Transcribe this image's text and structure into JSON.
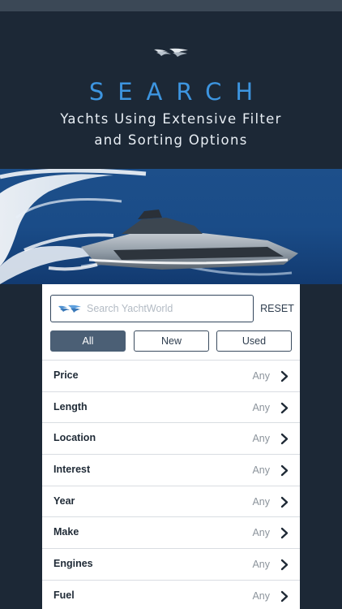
{
  "hero": {
    "headline": "SEARCH",
    "subline_1": "Yachts Using Extensive Filter",
    "subline_2": "and Sorting Options"
  },
  "search": {
    "placeholder": "Search YachtWorld",
    "value": "",
    "reset_label": "RESET"
  },
  "condition_tabs": [
    {
      "label": "All",
      "selected": true
    },
    {
      "label": "New",
      "selected": false
    },
    {
      "label": "Used",
      "selected": false
    }
  ],
  "filters": [
    {
      "label": "Price",
      "value": "Any"
    },
    {
      "label": "Length",
      "value": "Any"
    },
    {
      "label": "Location",
      "value": "Any"
    },
    {
      "label": "Interest",
      "value": "Any"
    },
    {
      "label": "Year",
      "value": "Any"
    },
    {
      "label": "Make",
      "value": "Any"
    },
    {
      "label": "Engines",
      "value": "Any"
    },
    {
      "label": "Fuel",
      "value": "Any"
    }
  ],
  "colors": {
    "background": "#1c2836",
    "accent": "#3d95e0",
    "active_tab": "#4b5f75",
    "border": "#33465c"
  },
  "icons": [
    "yachtworld-logo-icon",
    "chevron-right-icon"
  ]
}
